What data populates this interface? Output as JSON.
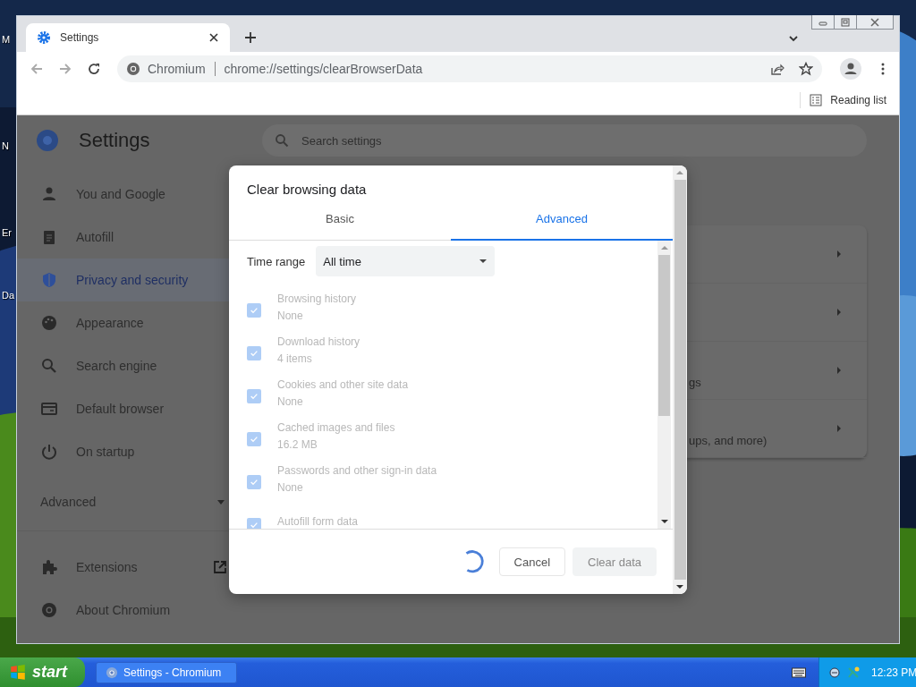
{
  "desktop": {
    "icon_labels": [
      "M",
      "N",
      "Er",
      "Da"
    ]
  },
  "browser": {
    "tabs": [
      {
        "title": "Settings",
        "selected": true
      }
    ],
    "address": {
      "site": "Chromium",
      "url": "chrome://settings/clearBrowserData"
    },
    "bookmarks_bar": {
      "reading_list": "Reading list"
    }
  },
  "settings": {
    "title": "Settings",
    "search": {
      "placeholder": "Search settings"
    },
    "nav": [
      {
        "label": "You and Google",
        "selected": false
      },
      {
        "label": "Autofill",
        "selected": false
      },
      {
        "label": "Privacy and security",
        "selected": true
      },
      {
        "label": "Appearance",
        "selected": false
      },
      {
        "label": "Search engine",
        "selected": false
      },
      {
        "label": "Default browser",
        "selected": false
      },
      {
        "label": "On startup",
        "selected": false
      }
    ],
    "advanced": {
      "label": "Advanced",
      "expanded": false
    },
    "nav_bottom": [
      {
        "label": "Extensions",
        "external": true
      },
      {
        "label": "About Chromium",
        "external": false
      }
    ],
    "card_rows": [
      {},
      {},
      {
        "text": "gs"
      },
      {
        "text": "ups, and more)"
      }
    ]
  },
  "dialog": {
    "title": "Clear browsing data",
    "tabs": [
      {
        "label": "Basic",
        "selected": false
      },
      {
        "label": "Advanced",
        "selected": true
      }
    ],
    "time_range": {
      "label": "Time range",
      "value": "All time"
    },
    "items": [
      {
        "label": "Browsing history",
        "detail": "None",
        "checked": true,
        "disabled": true
      },
      {
        "label": "Download history",
        "detail": "4 items",
        "checked": true,
        "disabled": true
      },
      {
        "label": "Cookies and other site data",
        "detail": "None",
        "checked": true,
        "disabled": true
      },
      {
        "label": "Cached images and files",
        "detail": "16.2 MB",
        "checked": true,
        "disabled": true
      },
      {
        "label": "Passwords and other sign-in data",
        "detail": "None",
        "checked": true,
        "disabled": true
      },
      {
        "label": "Autofill form data",
        "checked": true,
        "disabled": true
      }
    ],
    "loading": true,
    "buttons": [
      {
        "label": "Cancel",
        "disabled": false
      },
      {
        "label": "Clear data",
        "disabled": true
      }
    ]
  },
  "taskbar": {
    "start": "start",
    "tasks": [
      {
        "label": "Settings - Chromium"
      }
    ],
    "clock": "12:23 PM"
  }
}
